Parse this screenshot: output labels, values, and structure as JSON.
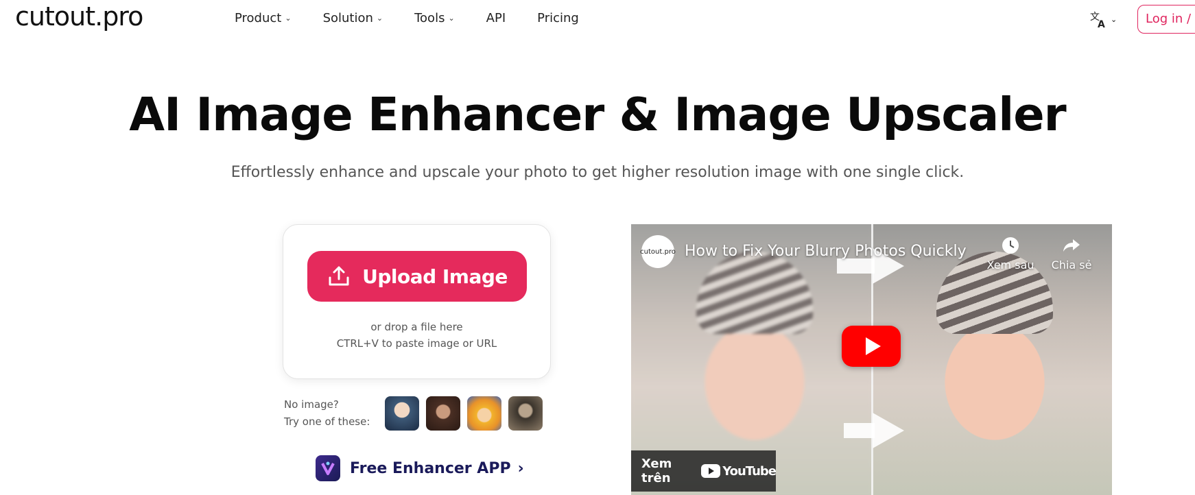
{
  "header": {
    "logo": "cutout.pro",
    "nav": [
      {
        "label": "Product",
        "has_dropdown": true
      },
      {
        "label": "Solution",
        "has_dropdown": true
      },
      {
        "label": "Tools",
        "has_dropdown": true
      },
      {
        "label": "API",
        "has_dropdown": false
      },
      {
        "label": "Pricing",
        "has_dropdown": false
      }
    ],
    "language_icon": "translate-icon",
    "login_label": "Log in / S"
  },
  "hero": {
    "title": "AI Image Enhancer & Image Upscaler",
    "subtitle": "Effortlessly enhance and upscale your photo to get higher resolution image with one single click."
  },
  "upload": {
    "button_label": "Upload Image",
    "drop_hint": "or drop a file here",
    "paste_hint": "CTRL+V to paste image or URL"
  },
  "samples": {
    "line1": "No image?",
    "line2": "Try one of these:"
  },
  "app": {
    "label": "Free Enhancer APP",
    "arrow": "›"
  },
  "video": {
    "channel": "cutout.pro",
    "title": "How to Fix Your Blurry Photos Quickly",
    "watch_later": "Xem sau",
    "share": "Chia sẻ",
    "watch_on": "Xem trên",
    "platform": "YouTube"
  },
  "colors": {
    "accent": "#e52a5c",
    "app_text": "#1a1a5a",
    "youtube_red": "#ff0000"
  }
}
